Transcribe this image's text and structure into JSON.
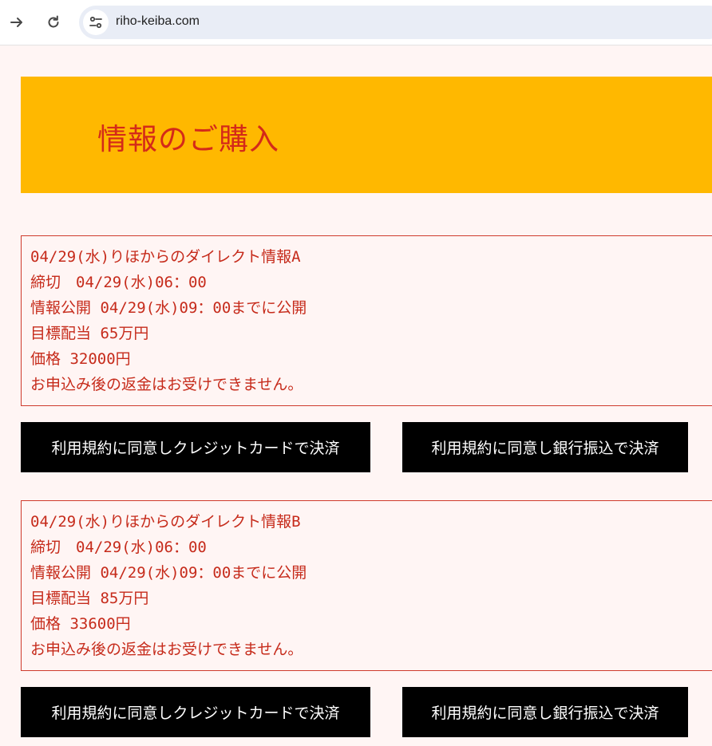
{
  "browser": {
    "url": "riho-keiba.com",
    "forward_icon": "arrow-right-icon",
    "reload_icon": "reload-icon",
    "site_info_icon": "tune-icon"
  },
  "header": {
    "title": "情報のご購入",
    "background_color": "#ffb800",
    "title_color": "#d42a19"
  },
  "products": [
    {
      "name": "04/29(水)りほからのダイレクト情報A",
      "deadline": "締切　04/29(水)06：00",
      "release": "情報公開 04/29(水)09：00までに公開",
      "target": "目標配当 65万円",
      "price": "価格 32000円",
      "notice": "お申込み後の返金はお受けできません。",
      "card_button": "利用規約に同意しクレジットカードで決済",
      "bank_button": "利用規約に同意し銀行振込で決済"
    },
    {
      "name": "04/29(水)りほからのダイレクト情報B",
      "deadline": "締切　04/29(水)06：00",
      "release": "情報公開 04/29(水)09：00までに公開",
      "target": "目標配当 85万円",
      "price": "価格 33600円",
      "notice": "お申込み後の返金はお受けできません。",
      "card_button": "利用規約に同意しクレジットカードで決済",
      "bank_button": "利用規約に同意し銀行振込で決済"
    }
  ]
}
